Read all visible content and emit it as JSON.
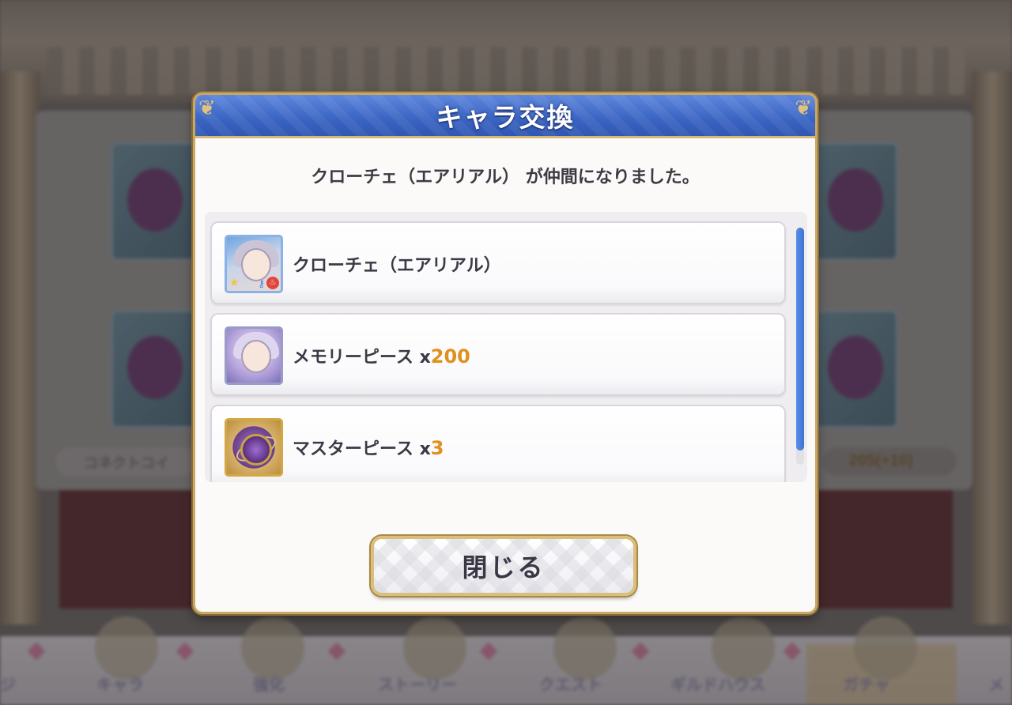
{
  "background": {
    "coin_label": "コネクトコイ",
    "coin_value": "205(+10)",
    "nav_items": [
      "ジ",
      "キャラ",
      "強化",
      "ストーリー",
      "クエスト",
      "ギルドハウス",
      "ガチャ",
      "メ"
    ]
  },
  "dialog": {
    "title": "キャラ交換",
    "message": "クローチェ（エアリアル） が仲間になりました。",
    "rewards": [
      {
        "icon": "character-icon",
        "name": "クローチェ（エアリアル）",
        "mult": "",
        "qty": ""
      },
      {
        "icon": "memory-piece-icon",
        "name": "メモリーピース ",
        "mult": "x",
        "qty": "200"
      },
      {
        "icon": "master-piece-icon",
        "name": "マスターピース ",
        "mult": "x",
        "qty": "3"
      }
    ],
    "close_label": "閉じる"
  },
  "colors": {
    "header_blue": "#3a64c2",
    "gold_border": "#caa864",
    "quantity_orange": "#e0901c",
    "scrollbar_blue": "#4a80dc"
  }
}
